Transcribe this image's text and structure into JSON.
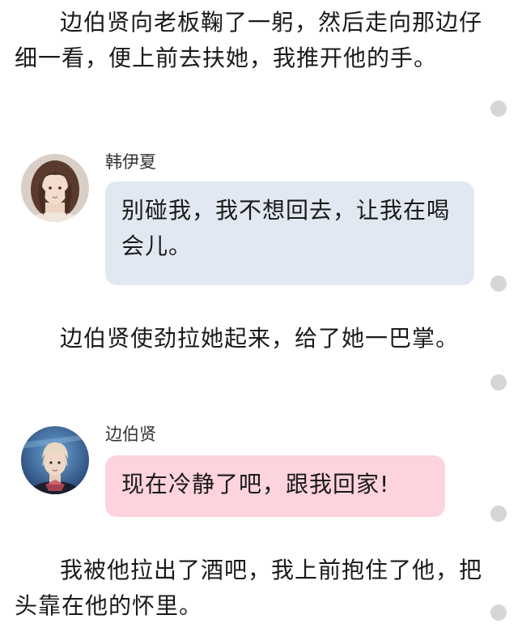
{
  "story": {
    "paragraph_1": "边伯贤向老板鞠了一躬，然后走向那边仔细一看，便上前去扶她，我推开他的手。",
    "message_1": {
      "speaker": "韩伊夏",
      "text": "别碰我，我不想回去，让我在喝会儿。"
    },
    "paragraph_2": "边伯贤使劲拉她起来，给了她一巴掌。",
    "message_2": {
      "speaker": "边伯贤",
      "text": "现在冷静了吧，跟我回家!"
    },
    "paragraph_3": "我被他拉出了酒吧，我上前抱住了他，把头靠在他的怀里。"
  },
  "colors": {
    "bubble_female": "#e1e8f1",
    "bubble_male": "#fdd3dd",
    "dot": "#d6d6d6"
  },
  "icons": {
    "dot": "comment-dot-icon",
    "avatar_female": "avatar-girl-icon",
    "avatar_male": "avatar-boy-icon"
  }
}
